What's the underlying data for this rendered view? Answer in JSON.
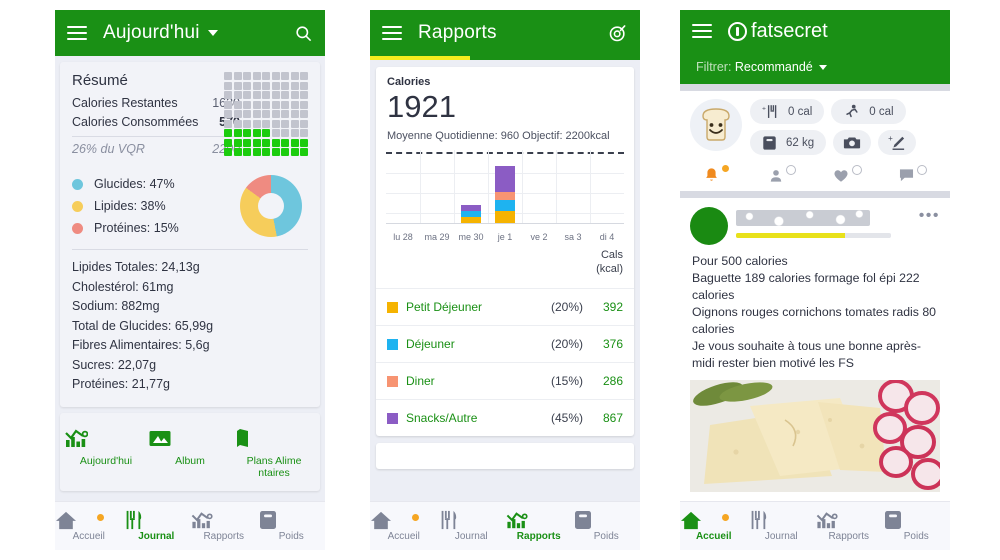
{
  "colors": {
    "brand_green": "#1a9015",
    "accent_yellow": "#f3ec1e",
    "grid_green": "#1ccc0e",
    "carb_blue": "#6ec6dd",
    "fat_yellow": "#f6cd5b",
    "protein_red": "#ef8b81",
    "bar_breakfast": "#f5b301",
    "bar_lunch": "#1eb3f0",
    "bar_dinner": "#f79472",
    "bar_snacks": "#8b5cc4",
    "badge_orange": "#f5a623"
  },
  "phone1": {
    "header": {
      "menu_icon": "hamburger-icon",
      "title": "Aujourd'hui",
      "dropdown_icon": "caret-down-icon",
      "search_icon": "search-icon"
    },
    "summary": {
      "title": "Résumé",
      "rows": [
        {
          "label": "Calories Restantes",
          "value": "1630"
        },
        {
          "label": "Calories Consommées",
          "value": "570"
        }
      ],
      "footer": {
        "label": "26% du VQR",
        "value": "2200"
      },
      "grid": {
        "columns": 9,
        "rows": 9,
        "filled_cells": 23
      }
    },
    "macros": [
      {
        "label": "Glucides: 47%",
        "percent": 47,
        "color": "#6ec6dd"
      },
      {
        "label": "Lipides: 38%",
        "percent": 38,
        "color": "#f6cd5b"
      },
      {
        "label": "Protéines: 15%",
        "percent": 15,
        "color": "#ef8b81"
      }
    ],
    "nutrition": [
      "Lipides Totales: 24,13g",
      "Cholestérol: 61mg",
      "Sodium: 882mg",
      "Total de Glucides: 65,99g",
      "Fibres Alimentaires: 5,6g",
      "Sucres: 22,07g",
      "Protéines: 21,77g"
    ],
    "quick_actions": [
      {
        "label": "Aujourd'hui",
        "icon": "reports-chart-icon"
      },
      {
        "label": "Album",
        "icon": "photo-album-icon"
      },
      {
        "label": "Plans Alime ntaires",
        "icon": "meal-plan-book-icon"
      }
    ],
    "bottom_nav": [
      {
        "label": "Accueil",
        "icon": "home-icon",
        "active": false,
        "badge": true
      },
      {
        "label": "Journal",
        "icon": "cutlery-icon",
        "active": true,
        "badge": false
      },
      {
        "label": "Rapports",
        "icon": "reports-chart-icon",
        "active": false,
        "badge": false
      },
      {
        "label": "Poids",
        "icon": "scale-icon",
        "active": false,
        "badge": false
      }
    ]
  },
  "phone2": {
    "header": {
      "menu_icon": "hamburger-icon",
      "title": "Rapports",
      "target_icon": "target-icon"
    },
    "calories_card": {
      "label": "Calories",
      "value": "1921",
      "subtitle": "Moyenne Quotidienne: 960  Objectif: 2200kcal"
    },
    "table": {
      "header_line1": "Cals",
      "header_line2": "(kcal)",
      "rows": [
        {
          "name": "Petit Déjeuner",
          "percent": "(20%)",
          "cals": "392",
          "color": "#f5b301"
        },
        {
          "name": "Déjeuner",
          "percent": "(20%)",
          "cals": "376",
          "color": "#1eb3f0"
        },
        {
          "name": "Diner",
          "percent": "(15%)",
          "cals": "286",
          "color": "#f79472"
        },
        {
          "name": "Snacks/Autre",
          "percent": "(45%)",
          "cals": "867",
          "color": "#8b5cc4"
        }
      ]
    },
    "bottom_nav": [
      {
        "label": "Accueil",
        "icon": "home-icon",
        "active": false,
        "badge": true
      },
      {
        "label": "Journal",
        "icon": "cutlery-icon",
        "active": false,
        "badge": false
      },
      {
        "label": "Rapports",
        "icon": "reports-chart-icon",
        "active": true,
        "badge": false
      },
      {
        "label": "Poids",
        "icon": "scale-icon",
        "active": false,
        "badge": false
      }
    ]
  },
  "phone3": {
    "header": {
      "menu_icon": "hamburger-icon",
      "brand": "fatsecret",
      "brand_icon": "fatsecret-logo-icon",
      "filter_label": "Filtrer:",
      "filter_value": "Recommandé",
      "filter_caret": "caret-down-icon"
    },
    "widget": {
      "avatar_icon": "toast-smiley-icon",
      "chips": [
        {
          "icon": "add-food-icon",
          "text": "0 cal"
        },
        {
          "icon": "exercise-run-icon",
          "text": "0 cal"
        },
        {
          "icon": "scale-icon",
          "text": "62 kg"
        },
        {
          "icon": "camera-icon",
          "text": ""
        },
        {
          "icon": "add-note-pencil-icon",
          "text": ""
        }
      ],
      "social": [
        {
          "icon": "bell-icon",
          "count": "",
          "active": true
        },
        {
          "icon": "person-icon",
          "count": "",
          "active": false
        },
        {
          "icon": "heart-icon",
          "count": "",
          "active": false
        },
        {
          "icon": "comment-icon",
          "count": "",
          "active": false
        }
      ]
    },
    "post": {
      "avatar": "user-avatar",
      "menu_icon": "more-options-icon",
      "progress_percent": 70,
      "text_lines": [
        "Pour 500 calories",
        "Baguette 189 calories formage fol épi 222 calories",
        "Oignons rouges cornichons tomates radis 80 calories",
        "Je vous souhaite à tous une bonne après-midi rester bien motivé les FS"
      ],
      "photo_alt": "cheese-pickles-radish-photo"
    },
    "bottom_nav": [
      {
        "label": "Accueil",
        "icon": "home-icon",
        "active": true,
        "badge": true
      },
      {
        "label": "Journal",
        "icon": "cutlery-icon",
        "active": false,
        "badge": false
      },
      {
        "label": "Rapports",
        "icon": "reports-chart-icon",
        "active": false,
        "badge": false
      },
      {
        "label": "Poids",
        "icon": "scale-icon",
        "active": false,
        "badge": false
      }
    ]
  },
  "chart_data": {
    "type": "bar",
    "title": "Calories",
    "subtitle": "Moyenne Quotidienne: 960  Objectif: 2200kcal",
    "categories": [
      "lu 28",
      "ma 29",
      "me 30",
      "je 1",
      "ve 2",
      "sa 3",
      "di 4"
    ],
    "series": [
      {
        "name": "Petit Déjeuner",
        "color": "#f5b301",
        "values": [
          0,
          0,
          205,
          392,
          0,
          0,
          0
        ]
      },
      {
        "name": "Déjeuner",
        "color": "#1eb3f0",
        "values": [
          0,
          0,
          200,
          376,
          0,
          0,
          0
        ]
      },
      {
        "name": "Diner",
        "color": "#f79472",
        "values": [
          0,
          0,
          0,
          286,
          0,
          0,
          0
        ]
      },
      {
        "name": "Snacks/Autre",
        "color": "#8b5cc4",
        "values": [
          0,
          0,
          190,
          867,
          0,
          0,
          0
        ]
      }
    ],
    "goal_line": 2200,
    "ylim": [
      0,
      2400
    ],
    "ylabel": "kcal",
    "grid": true,
    "legend": "table-below",
    "totals": {
      "me 30": 595,
      "je 1": 1921
    }
  }
}
